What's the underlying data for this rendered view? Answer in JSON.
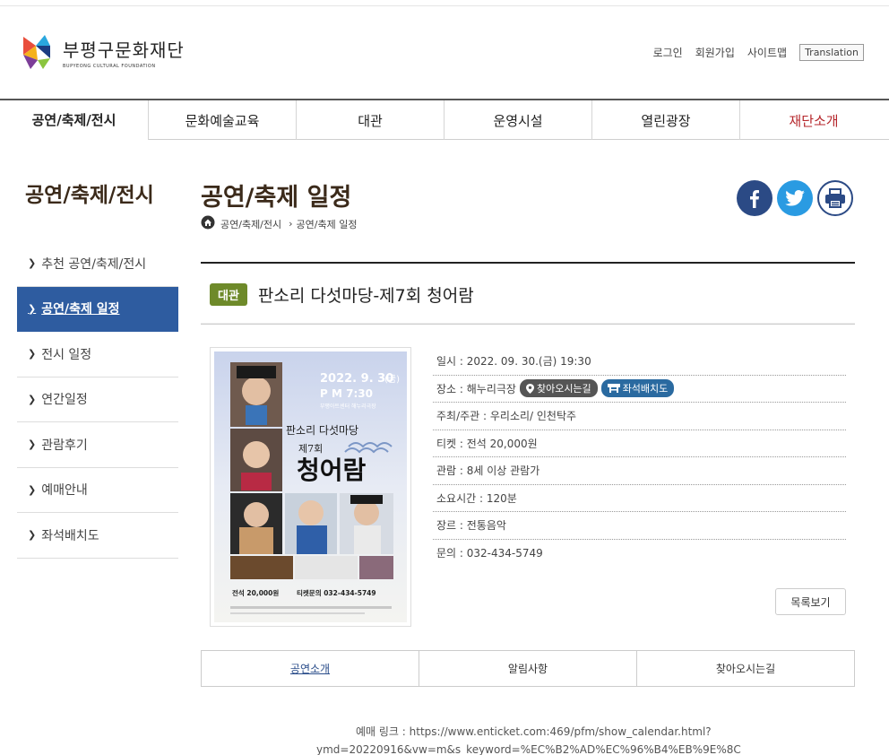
{
  "header": {
    "logo_ko": "부평구문화재단",
    "logo_en": "BUPYEONG CULTURAL FOUNDATION",
    "util": [
      "로그인",
      "회원가입",
      "사이트맵"
    ],
    "translation": "Translation"
  },
  "gnb": [
    "공연/축제/전시",
    "문화예술교육",
    "대관",
    "운영시설",
    "열린광장",
    "재단소개"
  ],
  "lnb": {
    "title": "공연/축제/전시",
    "items": [
      "추천 공연/축제/전시",
      "공연/축제 일정",
      "전시 일정",
      "연간일정",
      "관람후기",
      "예매안내",
      "좌석배치도"
    ]
  },
  "content": {
    "page_title": "공연/축제 일정",
    "breadcrumb": [
      "공연/축제/전시",
      "공연/축제 일정"
    ]
  },
  "event": {
    "badge": "대관",
    "title": "판소리 다섯마당-제7회 청어람",
    "info": {
      "date": "일시 : 2022. 09. 30.(금) 19:30",
      "place": "장소 : 해누리극장",
      "directions": "찾아오시는길",
      "seatmap": "좌석배치도",
      "host": "주최/주관 : 우리소리/ 인천탁주",
      "ticket": "티켓 : 전석 20,000원",
      "age": "관람 : 8세 이상 관람가",
      "duration": "소요시간 : 120분",
      "genre": "장르 : 전통음악",
      "contact": "문의 : 032-434-5749"
    },
    "list_button": "목록보기"
  },
  "poster": {
    "date_line": "2022. 9. 30",
    "day": "(금)",
    "time_line": "P M  7:30",
    "venue_line": "부평아트센터 해누리극장",
    "series": "판소리 다섯마당",
    "edition": "제7회",
    "main_title": "청어람",
    "price": "전석 20,000원",
    "phone": "티켓문의 032-434-5749"
  },
  "tabs": [
    "공연소개",
    "알림사항",
    "찾아오시는길"
  ],
  "reserve": {
    "line1": "예매 링크 : https://www.enticket.com:469/pfm/show_calendar.html?",
    "line2": "ymd=20220916&vw=m&s_keyword=%EC%B2%AD%EC%96%B4%EB%9E%8C"
  }
}
